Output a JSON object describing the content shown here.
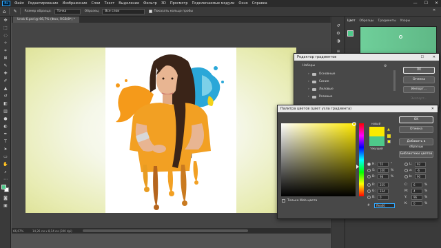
{
  "menu": {
    "logo": "Ps",
    "items": [
      "Файл",
      "Редактирование",
      "Изображение",
      "Слои",
      "Текст",
      "Выделение",
      "Фильтр",
      "3D",
      "Просмотр",
      "Подключаемые модули",
      "Окно",
      "Справка"
    ],
    "win_controls": [
      "—",
      "☐",
      "✕"
    ]
  },
  "options": {
    "sample_size_label": "Размер образца:",
    "sample_size_value": "Точка",
    "sample_label": "Образец:",
    "sample_value": "Все слои",
    "show_ring_label": "Показать кольцо пробы"
  },
  "document": {
    "tab_title": "Unsk 6.psd @ 66,7% (Фон, RGB/8*) *",
    "zoom": "66,67%",
    "size_info": "14,26 см x 8,14 см (300 dpi)"
  },
  "right_panel": {
    "tabs": [
      "Цвет",
      "Образцы",
      "Градиенты",
      "Узоры"
    ]
  },
  "gradient_editor": {
    "title": "Редактор градиентов",
    "presets_label": "Наборы",
    "presets": [
      "Основные",
      "Синие",
      "Лиловые",
      "Розовые"
    ],
    "ok": "OK",
    "cancel": "Отмена",
    "import": "Импорт...",
    "export": "Экспорт..."
  },
  "color_picker": {
    "title": "Палитра цветов (цвет узла градиента)",
    "new_label": "новый",
    "current_label": "текущий",
    "new_color": "#fbea00",
    "current_color": "#4ec98a",
    "ok": "OK",
    "cancel": "Отмена",
    "add_swatch": "Добавить в образцы",
    "libraries": "Библиотеки цветов",
    "web_only": "Только Web-цвета",
    "H": "55",
    "S": "100",
    "B": "98",
    "R": "255",
    "G": "234",
    "Bv": "0",
    "L": "92",
    "a": "-6",
    "b": "90",
    "C": "6",
    "M": "4",
    "Y": "96",
    "K": "0",
    "unit_deg": "°",
    "unit_pct": "%",
    "hex": "ffea00"
  }
}
